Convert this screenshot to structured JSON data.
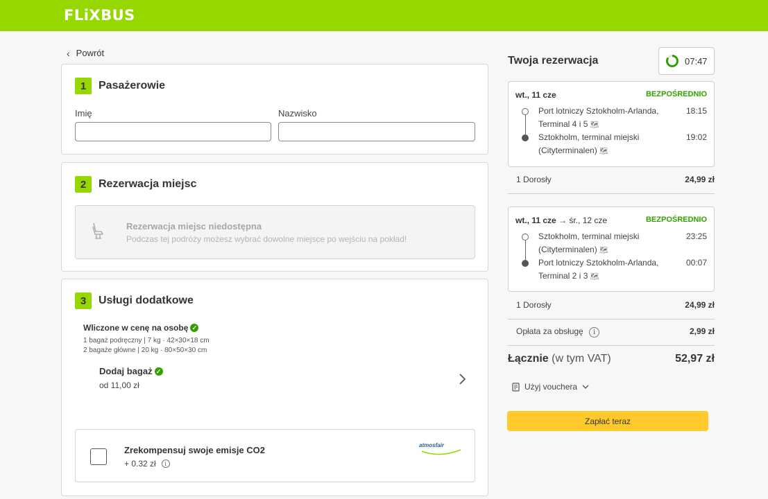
{
  "brand": "FLiXBUS",
  "colors": {
    "brand_green": "#97d700",
    "pay_yellow": "#ffc92b",
    "direct_green": "#31a100"
  },
  "nav": {
    "back_label": "Powrót"
  },
  "passengers": {
    "number": "1",
    "title": "Pasażerowie",
    "first_name_label": "Imię",
    "first_name_value": "",
    "last_name_label": "Nazwisko",
    "last_name_value": ""
  },
  "seats": {
    "number": "2",
    "title": "Rezerwacja miejsc",
    "unavailable_title": "Rezerwacja miejsc niedostępna",
    "unavailable_text": "Podczas tej podróży możesz wybrać dowolne miejsce po wejściu na pokład!"
  },
  "extras": {
    "number": "3",
    "title": "Usługi dodatkowe",
    "included_title": "Wliczone w cenę na osobę",
    "included_line1": "1 bagaż podręczny | 7 kg · 42×30×18 cm",
    "included_line2": "2 bagaże główne | 20 kg · 80×50×30 cm",
    "add_bag_title": "Dodaj bagaż",
    "add_bag_price": "od 11,00 zł",
    "co2_title": "Zrekompensuj swoje emisje CO2",
    "co2_price": "+ 0.32 zł",
    "co2_checked": false,
    "co2_partner": "atmosfair"
  },
  "summary": {
    "title": "Twoja rezerwacja",
    "timer": "07:47",
    "trips": [
      {
        "date": "wt., 11 cze",
        "date_extra": "",
        "badge": "BEZPOŚREDNIO",
        "from": [
          "Port lotniczy Sztokholm-Arlanda,",
          "Terminal 4 i 5"
        ],
        "from_time": "18:15",
        "to": [
          "Sztokholm, terminal miejski",
          "(Cityterminalen)"
        ],
        "to_time": "19:02",
        "pax": "1 Dorosły",
        "price": "24,99 zł"
      },
      {
        "date": "wt., 11 cze",
        "date_extra": " → śr., 12 cze",
        "badge": "BEZPOŚREDNIO",
        "from": [
          "Sztokholm, terminal miejski",
          "(Cityterminalen)"
        ],
        "from_time": "23:25",
        "to": [
          "Port lotniczy Sztokholm-Arlanda,",
          "Terminal 2 i 3"
        ],
        "to_time": "00:07",
        "pax": "1 Dorosły",
        "price": "24,99 zł"
      }
    ],
    "service_fee_label": "Opłata za obsługę",
    "service_fee": "2,99 zł",
    "total_label": "Łącznie",
    "total_vat": "(w tym VAT)",
    "total": "52,97 zł",
    "voucher_label": "Użyj vouchera",
    "pay_label": "Zapłać teraz"
  }
}
